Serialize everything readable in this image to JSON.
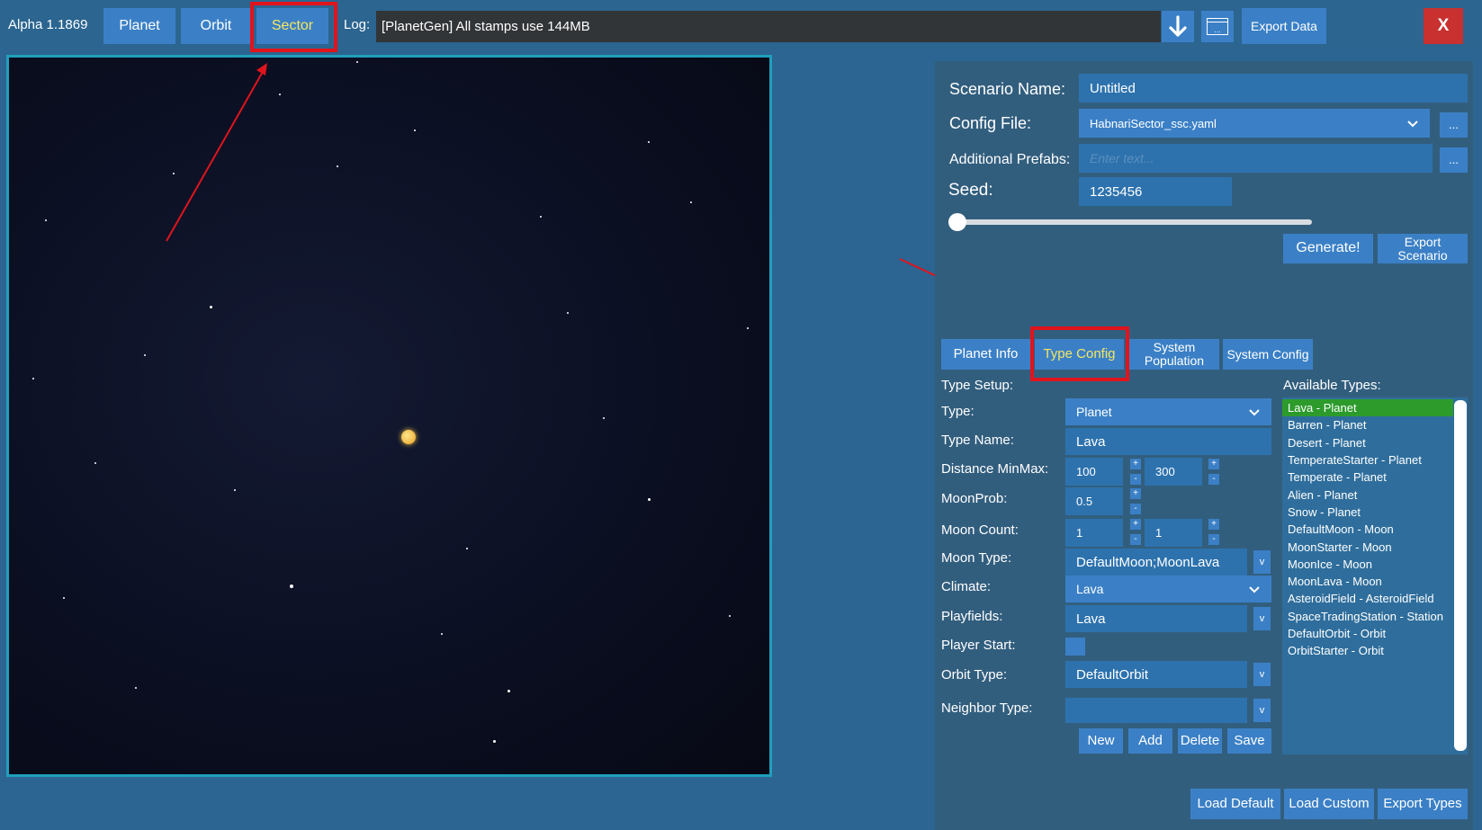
{
  "header": {
    "version": "Alpha 1.1869",
    "tabs": [
      {
        "label": "Planet"
      },
      {
        "label": "Orbit"
      },
      {
        "label": "Sector"
      }
    ],
    "log_label": "Log:",
    "log_text": "[PlanetGen] All stamps use 144MB",
    "download_icon": "download-arrow-icon",
    "folder_icon": "folder-browse-icon",
    "folder_text": "...",
    "export_data": "Export Data",
    "close": "X"
  },
  "scenario": {
    "name_label": "Scenario Name:",
    "name_value": "Untitled",
    "config_label": "Config File:",
    "config_value": "HabnariSector_ssc.yaml",
    "config_browse": "...",
    "prefabs_label": "Additional Prefabs:",
    "prefabs_placeholder": "Enter text...",
    "prefabs_browse": "...",
    "seed_label": "Seed:",
    "seed_value": "1235456",
    "seed_slider_value": 0,
    "generate": "Generate!",
    "export_scenario": "Export Scenario"
  },
  "tabs": [
    {
      "label": "Planet Info"
    },
    {
      "label": "Type Config"
    },
    {
      "label": "System Population"
    },
    {
      "label": "System Config"
    }
  ],
  "type_setup": {
    "heading": "Type Setup:",
    "type_label": "Type:",
    "type_value": "Planet",
    "type_name_label": "Type Name:",
    "type_name_value": "Lava",
    "distance_label": "Distance MinMax:",
    "distance_min": "100",
    "distance_max": "300",
    "moonprob_label": "MoonProb:",
    "moonprob_value": "0.5",
    "mooncount_label": "Moon Count:",
    "mooncount_min": "1",
    "mooncount_max": "1",
    "moontype_label": "Moon Type:",
    "moontype_value": "DefaultMoon;MoonLava",
    "climate_label": "Climate:",
    "climate_value": "Lava",
    "playfields_label": "Playfields:",
    "playfields_value": "Lava",
    "playerstart_label": "Player Start:",
    "orbittype_label": "Orbit Type:",
    "orbittype_value": "DefaultOrbit",
    "neighbor_label": "Neighbor Type:",
    "neighbor_value": "",
    "plus": "+",
    "minus": "-",
    "dropdown_glyph": "v",
    "new": "New",
    "add": "Add",
    "delete": "Delete",
    "save": "Save"
  },
  "available": {
    "heading": "Available Types:",
    "items": [
      "Lava - Planet",
      "Barren - Planet",
      "Desert - Planet",
      "TemperateStarter - Planet",
      "Temperate - Planet",
      "Alien - Planet",
      "Snow - Planet",
      "DefaultMoon - Moon",
      "MoonStarter - Moon",
      "MoonIce - Moon",
      "MoonLava - Moon",
      "AsteroidField - AsteroidField",
      "SpaceTradingStation - Station",
      "DefaultOrbit - Orbit",
      "OrbitStarter - Orbit"
    ]
  },
  "footer": {
    "load_default": "Load Default",
    "load_custom": "Load Custom",
    "export_types": "Export Types"
  },
  "colors": {
    "background": "#2c6591",
    "button": "#3b80c6",
    "active_text": "#f5e663",
    "highlight": "#e0141c",
    "selected_item": "#2c9b2c",
    "close_button": "#c8312f"
  }
}
